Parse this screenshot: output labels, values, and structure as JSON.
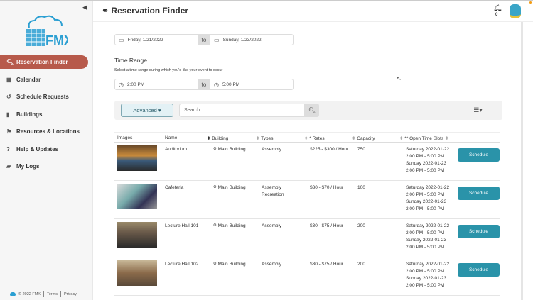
{
  "sidebar": {
    "brand": "FMX",
    "items": [
      {
        "label": "Reservation Finder",
        "icon": "search-icon",
        "active": true
      },
      {
        "label": "Calendar",
        "icon": "calendar-icon"
      },
      {
        "label": "Schedule Requests",
        "icon": "history-icon"
      },
      {
        "label": "Buildings",
        "icon": "building-icon"
      },
      {
        "label": "Resources & Locations",
        "icon": "flag-icon"
      },
      {
        "label": "Help & Updates",
        "icon": "help-icon"
      },
      {
        "label": "My Logs",
        "icon": "logs-icon"
      }
    ],
    "footer": {
      "copyright": "© 2022 FMX",
      "terms": "Terms",
      "privacy": "Privacy"
    }
  },
  "header": {
    "title": "Reservation Finder",
    "notifications": "0"
  },
  "date_range": {
    "start": "Friday, 1/21/2022",
    "to": "to",
    "end": "Sunday, 1/23/2022"
  },
  "time_range": {
    "label": "Time Range",
    "help": "Select a time range during which you'd like your event to occur",
    "start": "2:00 PM",
    "to": "to",
    "end": "5:00 PM"
  },
  "toolbar": {
    "advanced": "Advanced",
    "search_placeholder": "Search"
  },
  "table": {
    "headers": [
      "Images",
      "Name",
      "Building",
      "Types",
      "* Rates",
      "Capacity",
      "** Open Time Slots"
    ],
    "schedule_label": "Schedule",
    "rows": [
      {
        "name": "Auditorium",
        "building": "Main Building",
        "types": [
          "Assembly"
        ],
        "rates": "$225 - $300 / Hour",
        "capacity": "750",
        "slots": [
          "Saturday 2022-01-22",
          "2:00 PM - 5:00 PM",
          "Sunday 2022-01-23",
          "2:00 PM - 5:00 PM"
        ]
      },
      {
        "name": "Cafeteria",
        "building": "Main Building",
        "types": [
          "Assembly",
          "Recreation"
        ],
        "rates": "$30 - $70 / Hour",
        "capacity": "100",
        "slots": [
          "Saturday 2022-01-22",
          "2:00 PM - 5:00 PM",
          "Sunday 2022-01-23",
          "2:00 PM - 5:00 PM"
        ]
      },
      {
        "name": "Lecture Hall 101",
        "building": "Main Building",
        "types": [
          "Assembly"
        ],
        "rates": "$30 - $75 / Hour",
        "capacity": "200",
        "slots": [
          "Saturday 2022-01-22",
          "2:00 PM - 5:00 PM",
          "Sunday 2022-01-23",
          "2:00 PM - 5:00 PM"
        ]
      },
      {
        "name": "Lecture Hall 102",
        "building": "Main Building",
        "types": [
          "Assembly"
        ],
        "rates": "$30 - $75 / Hour",
        "capacity": "200",
        "slots": [
          "Saturday 2022-01-22",
          "2:00 PM - 5:00 PM",
          "Sunday 2022-01-23",
          "2:00 PM - 5:00 PM"
        ]
      }
    ]
  },
  "colors": {
    "active_nav": "#b75a4b",
    "schedule_button": "#2a93a9",
    "brand": "#2b9fd2"
  }
}
